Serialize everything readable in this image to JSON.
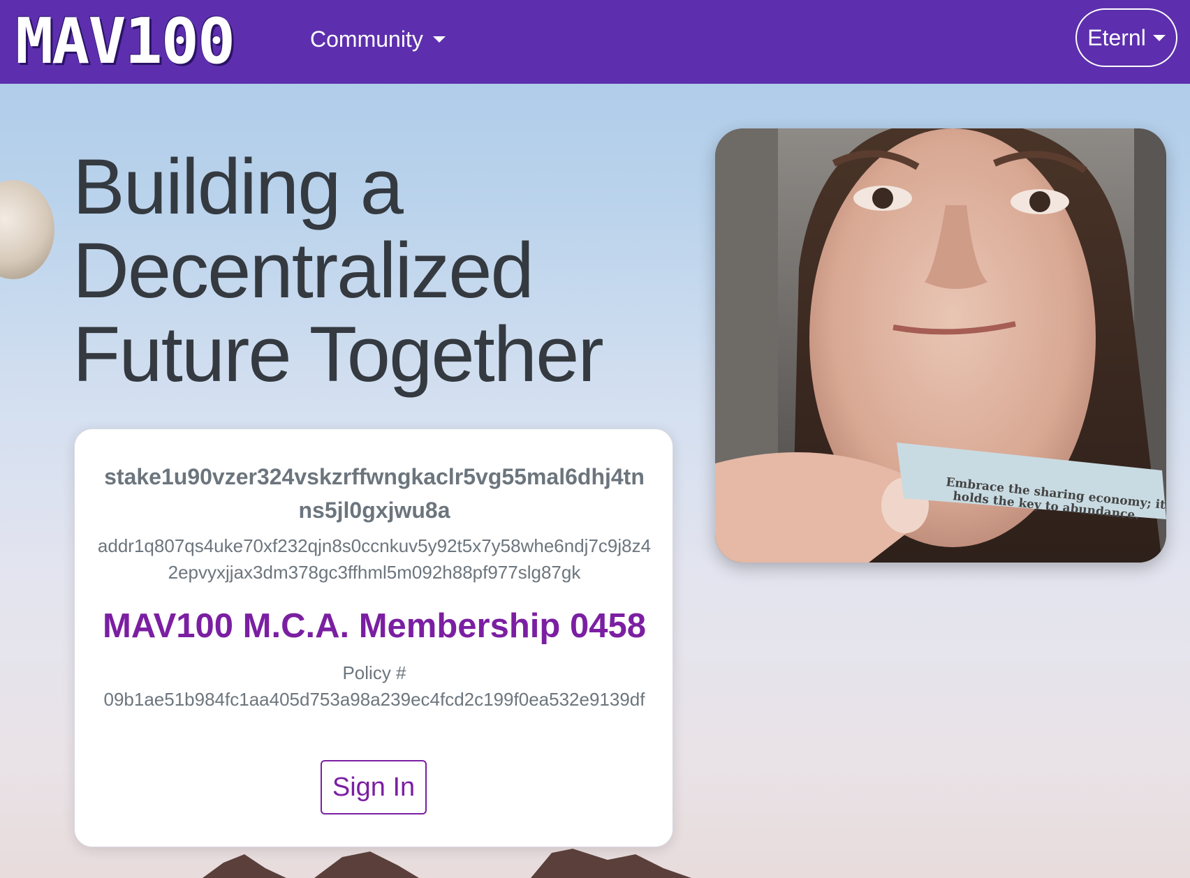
{
  "navbar": {
    "logo_text": "MAV100",
    "community_label": "Community",
    "wallet_label": "Eternl",
    "background_color": "#5d2fae"
  },
  "hero": {
    "title": "Building a Decentralized Future Together"
  },
  "card": {
    "stake_address": "stake1u90vzer324vskzrffwngkaclr5vg55mal6dhj4tnns5jl0gxjwu8a",
    "payment_address": "addr1q807qs4uke70xf232qjn8s0ccnkuv5y92t5x7y58whe6ndj7c9j8z42epvyxjjax3dm378gc3ffhml5m092h88pf977slg87gk",
    "membership_title": "MAV100 M.C.A. Membership 0458",
    "policy_label": "Policy #",
    "policy_id": "09b1ae51b984fc1aa405d753a98a239ec4fcd2c199f0ea532e9139df",
    "sign_in_label": "Sign In",
    "accent_color": "#7b1fa2"
  },
  "photo": {
    "caption_text": "Embrace the sharing economy; it holds the key to abundance."
  }
}
